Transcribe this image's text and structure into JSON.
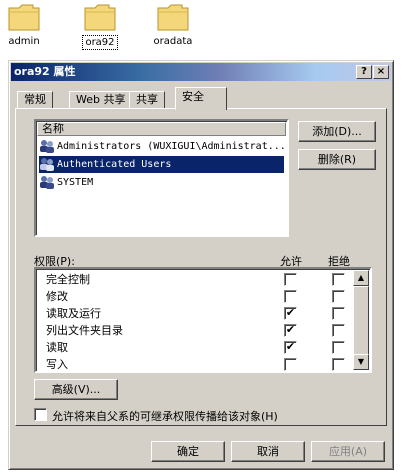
{
  "desktop": {
    "folders": [
      {
        "label": "admin"
      },
      {
        "label": "ora92"
      },
      {
        "label": "oradata"
      }
    ]
  },
  "window": {
    "title": "ora92 属性",
    "help_button": "?",
    "close_button": "×"
  },
  "tabs": [
    {
      "label": "常规"
    },
    {
      "label": "Web 共享"
    },
    {
      "label": "共享"
    },
    {
      "label": "安全"
    }
  ],
  "users": {
    "header": "名称",
    "items": [
      {
        "label": "Administrators (WUXIGUI\\Administrat..."
      },
      {
        "label": "Authenticated Users"
      },
      {
        "label": "SYSTEM"
      }
    ],
    "add_button": "添加(D)...",
    "remove_button": "删除(R)"
  },
  "permissions": {
    "label": "权限(P):",
    "allow_header": "允许",
    "deny_header": "拒绝",
    "items": [
      {
        "name": "完全控制",
        "allow": "",
        "deny": ""
      },
      {
        "name": "修改",
        "allow": "",
        "deny": ""
      },
      {
        "name": "读取及运行",
        "allow": "✔",
        "deny": ""
      },
      {
        "name": "列出文件夹目录",
        "allow": "✔",
        "deny": ""
      },
      {
        "name": "读取",
        "allow": "✔",
        "deny": ""
      },
      {
        "name": "写入",
        "allow": "",
        "deny": ""
      }
    ],
    "scroll_up": "▲",
    "scroll_down": "▼"
  },
  "advanced_button": "高级(V)...",
  "inherit_checkbox": {
    "label": "允许将来自父系的可继承权限传播给该对象(H)",
    "checked": ""
  },
  "footer": {
    "ok": "确定",
    "cancel": "取消",
    "apply": "应用(A)"
  },
  "colors": {
    "titlebar_start": "#0a246a",
    "selection": "#0a246a",
    "face": "#d4d0c8",
    "folder": "#f4d77a"
  }
}
